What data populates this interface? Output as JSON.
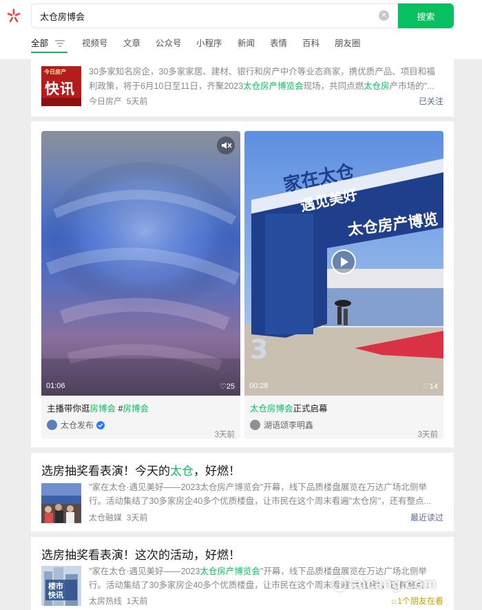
{
  "search": {
    "query": "太仓房博会",
    "button": "搜索"
  },
  "tabs": [
    "全部",
    "视频号",
    "文章",
    "公众号",
    "小程序",
    "新闻",
    "表情",
    "百科",
    "朋友圈"
  ],
  "news_card": {
    "thumb_top": "今日房产",
    "thumb_main": "快讯",
    "desc_1": "30多家知名房企，30多家家居、建材、银行和房产中介等业态商家，携优质产品、项目和福利政策，将于6月10日至11日，齐聚2023",
    "desc_hl_1": "太仓房产博览会",
    "desc_2": "现场，共同点燃",
    "desc_hl_2": "太仓房",
    "desc_3": "产市场的\"...",
    "source": "今日房产",
    "time": "5天前",
    "follow_status": "已关注"
  },
  "videos": [
    {
      "duration": "01:06",
      "likes": "♡25",
      "title_1": "主播带你逛",
      "title_hl_1": "房博会",
      "title_2": " #",
      "title_hl_2": "房博会",
      "author": "太仓发布",
      "time": "3天前"
    },
    {
      "duration": "00:28",
      "likes": "♡14",
      "title_hl_1": "太仓房博会",
      "title_1": "正式启幕",
      "author": "湖语颂李明鑫",
      "time": "3天前",
      "arch_text_1": "家在太仓",
      "arch_text_2": "遇见美好",
      "arch_text_3": "太仓房产博览",
      "digit": "3"
    }
  ],
  "articles": [
    {
      "title_1": "选房抽奖看表演！今天的",
      "title_hl": "太仓",
      "title_2": "，好燃！",
      "desc": "\"家在太仓·遇见美好——2023太仓房产博览会\"开幕，线下品质楼盘展览在万达广场北侧举行。活动集结了30多家房企40多个优质楼盘，让市民在这个周末看遍\"太仓房\"，还有整点...",
      "source": "太仓融媒",
      "time": "3天前",
      "right": "最近读过"
    },
    {
      "title": "选房抽奖看表演！这次的活动，好燃！",
      "desc_1": "\"家在太仓·遇见美好——2023",
      "desc_hl": "太仓房产博览会",
      "desc_2": "\"开幕，线下品质楼盘展览在万达广场北侧举行。活动集结了30多家房企40多个优质楼盘，让市民在这个周末看遍\"太仓房\"，还有整点...",
      "source": "太房热线",
      "time": "1天前",
      "right": "☼1个朋友在看",
      "thumb_text_1": "楼市",
      "thumb_text_2": "快讯"
    }
  ],
  "watermark": "taicang.com",
  "colors": {
    "accent": "#07c160",
    "link": "#576b95",
    "friend": "#c8a100",
    "news_red": "#b51d1d"
  }
}
